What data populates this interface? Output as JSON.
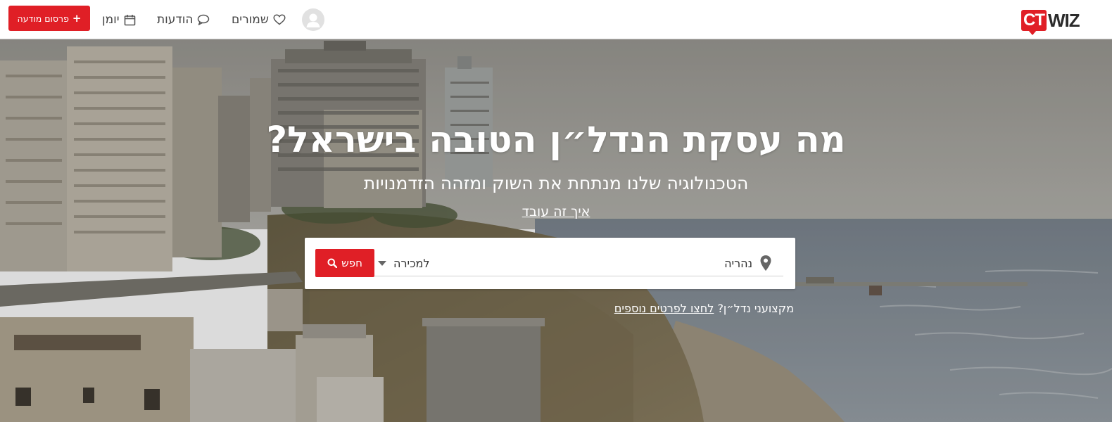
{
  "header": {
    "logo": {
      "ct": "CT",
      "wiz": "WIZ"
    },
    "post_button": {
      "label": "פרסום מודעה",
      "icon": "plus-icon"
    },
    "nav": {
      "calendar": {
        "label": "יומן",
        "icon": "calendar-icon"
      },
      "messages": {
        "label": "הודעות",
        "icon": "chat-bubble-icon"
      },
      "saved": {
        "label": "שמורים",
        "icon": "heart-icon"
      }
    },
    "avatar": {
      "icon": "user-avatar-icon"
    }
  },
  "hero": {
    "title": "מה עסקת הנדל״ן הטובה בישראל?",
    "subtitle": "הטכנולוגיה שלנו מנתחת את השוק ומזהה הזדמנויות",
    "how_link": "איך זה עובד",
    "search": {
      "location_value": "נהריה",
      "location_icon": "map-pin-icon",
      "deal_type_selected": "למכירה",
      "button_label": "חפש",
      "button_icon": "search-icon"
    },
    "pros": {
      "question": "מקצועני נדל״ן?",
      "link": "לחצו לפרטים נוספים"
    }
  },
  "colors": {
    "accent": "#e01f26",
    "header_bg": "#ffffff"
  }
}
